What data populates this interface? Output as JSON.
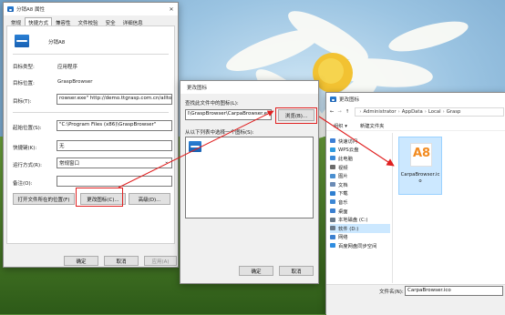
{
  "props": {
    "title": "分销A8 属性",
    "tabs": [
      "常规",
      "快捷方式",
      "兼容性",
      "文件校验",
      "安全",
      "详细信息"
    ],
    "active_tab": 1,
    "app_name": "分销A8",
    "rows": [
      {
        "label": "目标类型:",
        "value": "应用程序"
      },
      {
        "label": "目标位置:",
        "value": "GraspBrowser"
      }
    ],
    "target_label": "目标(T):",
    "target_value": "rowser.exe\" http://demo.ttgrasp.com.cn/alltop",
    "start_label": "起始位置(S):",
    "start_value": "\"C:\\Program Files (x86)\\GraspBrowser\"",
    "hotkey_label": "快捷键(K):",
    "hotkey_value": "无",
    "run_label": "运行方式(R):",
    "run_value": "常规窗口",
    "comment_label": "备注(O):",
    "comment_value": "",
    "open_location_btn": "打开文件所在的位置(F)",
    "change_icon_btn": "更改图标(C)...",
    "advanced_btn": "高级(D)...",
    "ok": "确定",
    "cancel": "取消",
    "apply": "应用(A)"
  },
  "change_icon": {
    "title": "更改图标",
    "find_label": "查找此文件中的图标(L):",
    "path_value": "l\\GraspBrowser\\CarpaBrowser.exe",
    "browse_btn": "浏览(B)...",
    "list_label": "从以下列表中选择一个图标(S):",
    "ok": "确定",
    "cancel": "取消"
  },
  "explorer": {
    "title": "更改图标",
    "breadcrumb": [
      "Administrator",
      "AppData",
      "Local",
      "Grasp"
    ],
    "organize": "组织 ▾",
    "new_folder": "新建文件夹",
    "nav": [
      {
        "label": "快速访问",
        "color": "#3b7fd6"
      },
      {
        "label": "WPS云盘",
        "color": "#2f9be0"
      },
      {
        "label": "此电脑",
        "color": "#3a8ad8"
      },
      {
        "label": "视频",
        "color": "#6b6b6b"
      },
      {
        "label": "图片",
        "color": "#4a8fd0"
      },
      {
        "label": "文档",
        "color": "#6b8bb5"
      },
      {
        "label": "下载",
        "color": "#2f7fd0"
      },
      {
        "label": "音乐",
        "color": "#3c86d4"
      },
      {
        "label": "桌面",
        "color": "#3a7fd0"
      },
      {
        "label": "本地磁盘 (C:)",
        "color": "#6a7a8a"
      },
      {
        "label": "软件 (D:)",
        "color": "#6a7a8a"
      },
      {
        "label": "网络",
        "color": "#3a7fd0"
      },
      {
        "label": "百度网盘同步空间",
        "color": "#2f8de0"
      }
    ],
    "selected_nav": 10,
    "file_name": "CarpaBrowser.ico",
    "icon_text": "A8",
    "filename_label": "文件名(N):",
    "filename_value": "CarpaBrowser.ico"
  },
  "colors": {
    "accent_red": "#e02020",
    "select_blue": "#cce8ff",
    "icon_orange": "#f28b20"
  }
}
